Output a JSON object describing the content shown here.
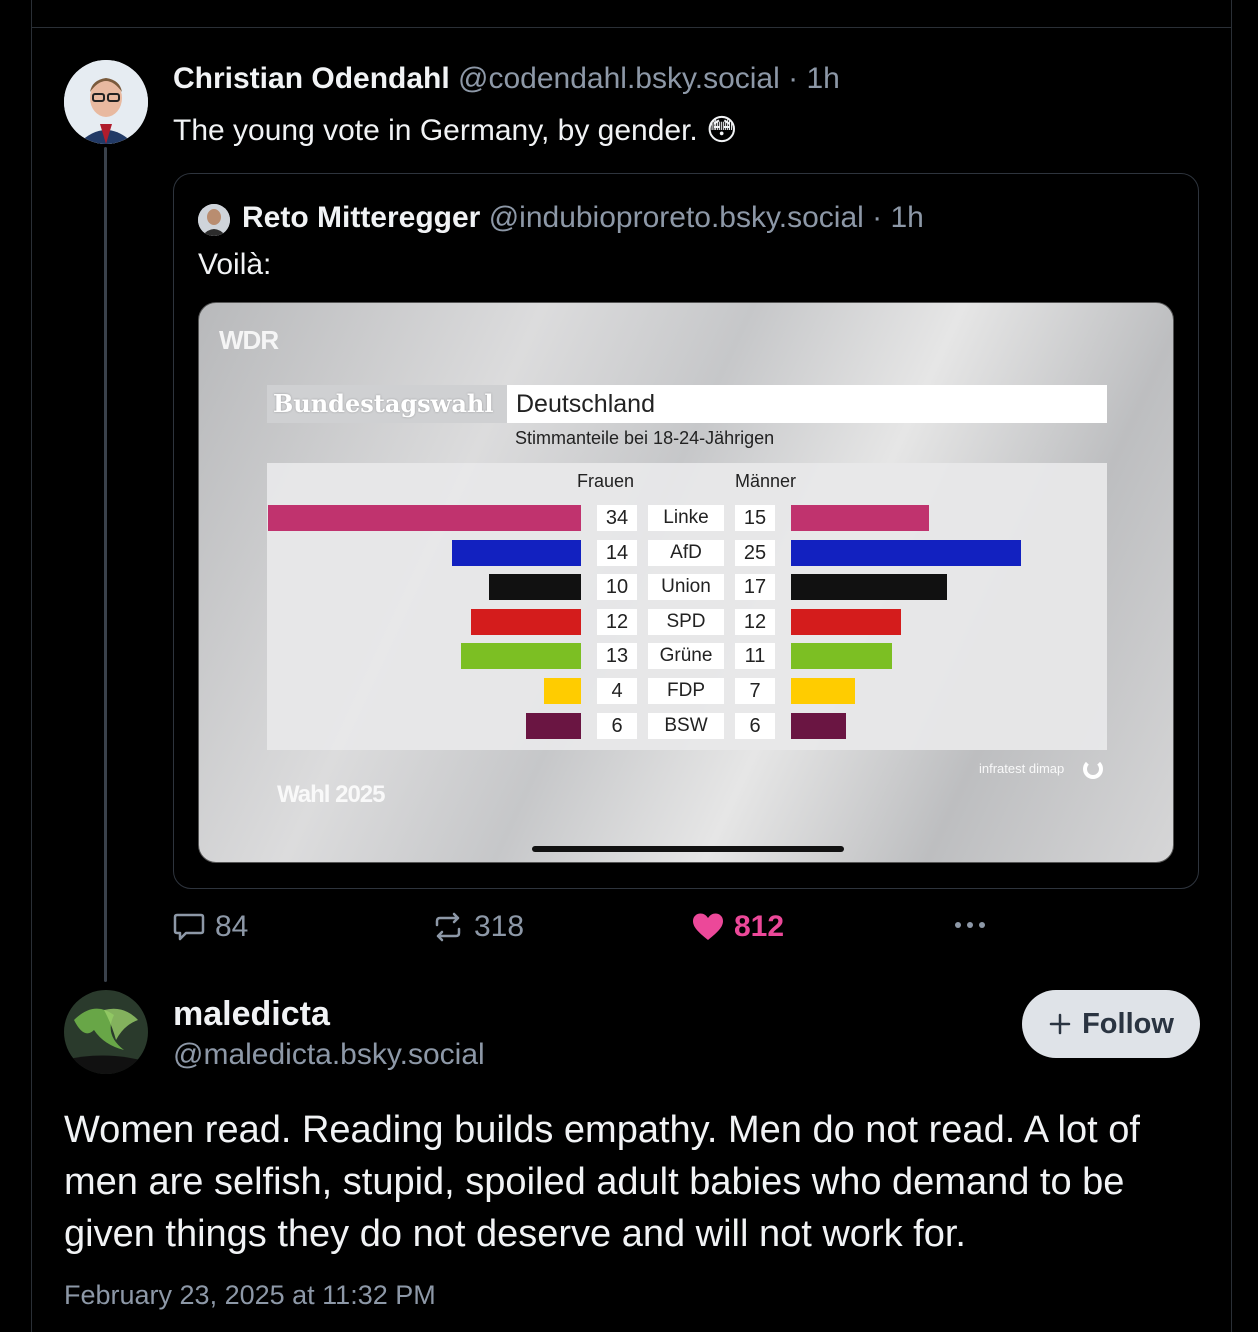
{
  "post1": {
    "author_name": "Christian Odendahl",
    "handle_time": "@codendahl.bsky.social · 1h",
    "text": "The young vote in Germany, by gender. 😳",
    "quote": {
      "author_name": "Reto Mitteregger",
      "handle_time": "@indubioproreto.bsky.social · 1h",
      "text": "Voilà:"
    },
    "image": {
      "logo": "WDR",
      "header_left": "Bundestagswahl",
      "header_right": "Deutschland",
      "subtitle": "Stimmanteile bei 18-24-Jährigen",
      "col_left": "Frauen",
      "col_right": "Männer",
      "footer_left": "Wahl 2025",
      "source": "infratest dimap"
    },
    "actions": {
      "replies": "84",
      "reposts": "318",
      "likes": "812"
    }
  },
  "post2": {
    "author_name": "maledicta",
    "handle": "@maledicta.bsky.social",
    "follow_label": "Follow",
    "text": "Women read. Reading builds empathy. Men do not read. A lot of men are selfish, stupid, spoiled adult babies who demand to be given things they do not deserve and will not work for.",
    "timestamp": "February 23, 2025 at 11:32 PM"
  },
  "colors": {
    "like": "#ec4899",
    "muted": "#8d98a7",
    "border": "#2e343d"
  },
  "chart_data": {
    "type": "bar",
    "orientation": "horizontal-mirrored",
    "categories": [
      "Linke",
      "AfD",
      "Union",
      "SPD",
      "Grüne",
      "FDP",
      "BSW"
    ],
    "series": [
      {
        "name": "Frauen",
        "values": [
          34,
          14,
          10,
          12,
          13,
          4,
          6
        ]
      },
      {
        "name": "Männer",
        "values": [
          15,
          25,
          17,
          12,
          11,
          7,
          6
        ]
      }
    ],
    "category_colors": [
      "#c0336e",
      "#1221c0",
      "#111111",
      "#d41c1c",
      "#7cbf23",
      "#ffcc00",
      "#6a1542"
    ],
    "title": "Deutschland",
    "subtitle": "Stimmanteile bei 18-24-Jährigen"
  }
}
